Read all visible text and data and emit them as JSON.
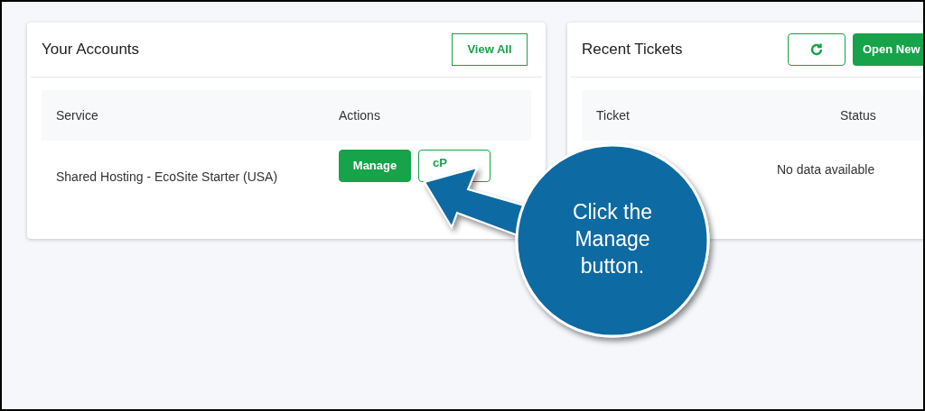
{
  "accounts": {
    "title": "Your Accounts",
    "view_all": "View All",
    "columns": [
      "Service",
      "Actions"
    ],
    "rows": [
      {
        "service": "Shared Hosting - EcoSite Starter (USA)",
        "actions": [
          {
            "label": "Manage",
            "kind": "primary"
          },
          {
            "label": "cP",
            "kind": "outline"
          }
        ]
      }
    ]
  },
  "tickets": {
    "title": "Recent Tickets",
    "open_new": "Open New",
    "columns": [
      "Ticket",
      "Status"
    ],
    "empty": "No data available"
  },
  "callout": {
    "text": "Click the\nManage\nbutton."
  }
}
